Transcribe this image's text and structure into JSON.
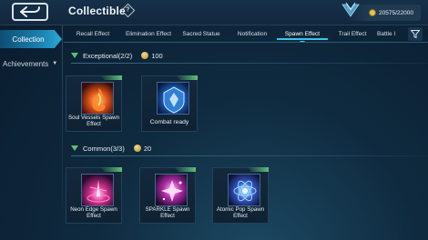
{
  "header": {
    "title": "Collectible",
    "info_symbol": "?",
    "currency_amount": "20575/22000"
  },
  "sidebar": {
    "items": [
      {
        "label": "Collection",
        "active": true
      },
      {
        "label": "Achievements",
        "active": false
      }
    ]
  },
  "tabs": [
    {
      "label": "Recall Effect",
      "active": false
    },
    {
      "label": "Elimination Effect",
      "active": false
    },
    {
      "label": "Sacred Statue",
      "active": false
    },
    {
      "label": "Notification",
      "active": false
    },
    {
      "label": "Spawn Effect",
      "active": true
    },
    {
      "label": "Trail Effect",
      "active": false
    },
    {
      "label": "Battle I",
      "active": false
    }
  ],
  "sections": [
    {
      "title": "Exceptional(2/2)",
      "points": "100",
      "items": [
        {
          "label": "Soul Vessels Spawn Effect",
          "icon": "soul-vessels-icon"
        },
        {
          "label": "Combat ready",
          "icon": "combat-ready-icon"
        }
      ]
    },
    {
      "title": "Common(3/3)",
      "points": "20",
      "items": [
        {
          "label": "Neon Edge Spawn Effect",
          "icon": "neon-edge-icon"
        },
        {
          "label": "SPARKLE Spawn Effect",
          "icon": "sparkle-icon"
        },
        {
          "label": "Atomic Pop Spawn Effect",
          "icon": "atomic-pop-icon"
        }
      ]
    }
  ],
  "colors": {
    "accent": "#39c3f0",
    "section_marker": "#5fbf7a",
    "background": "#0f2a3f"
  }
}
